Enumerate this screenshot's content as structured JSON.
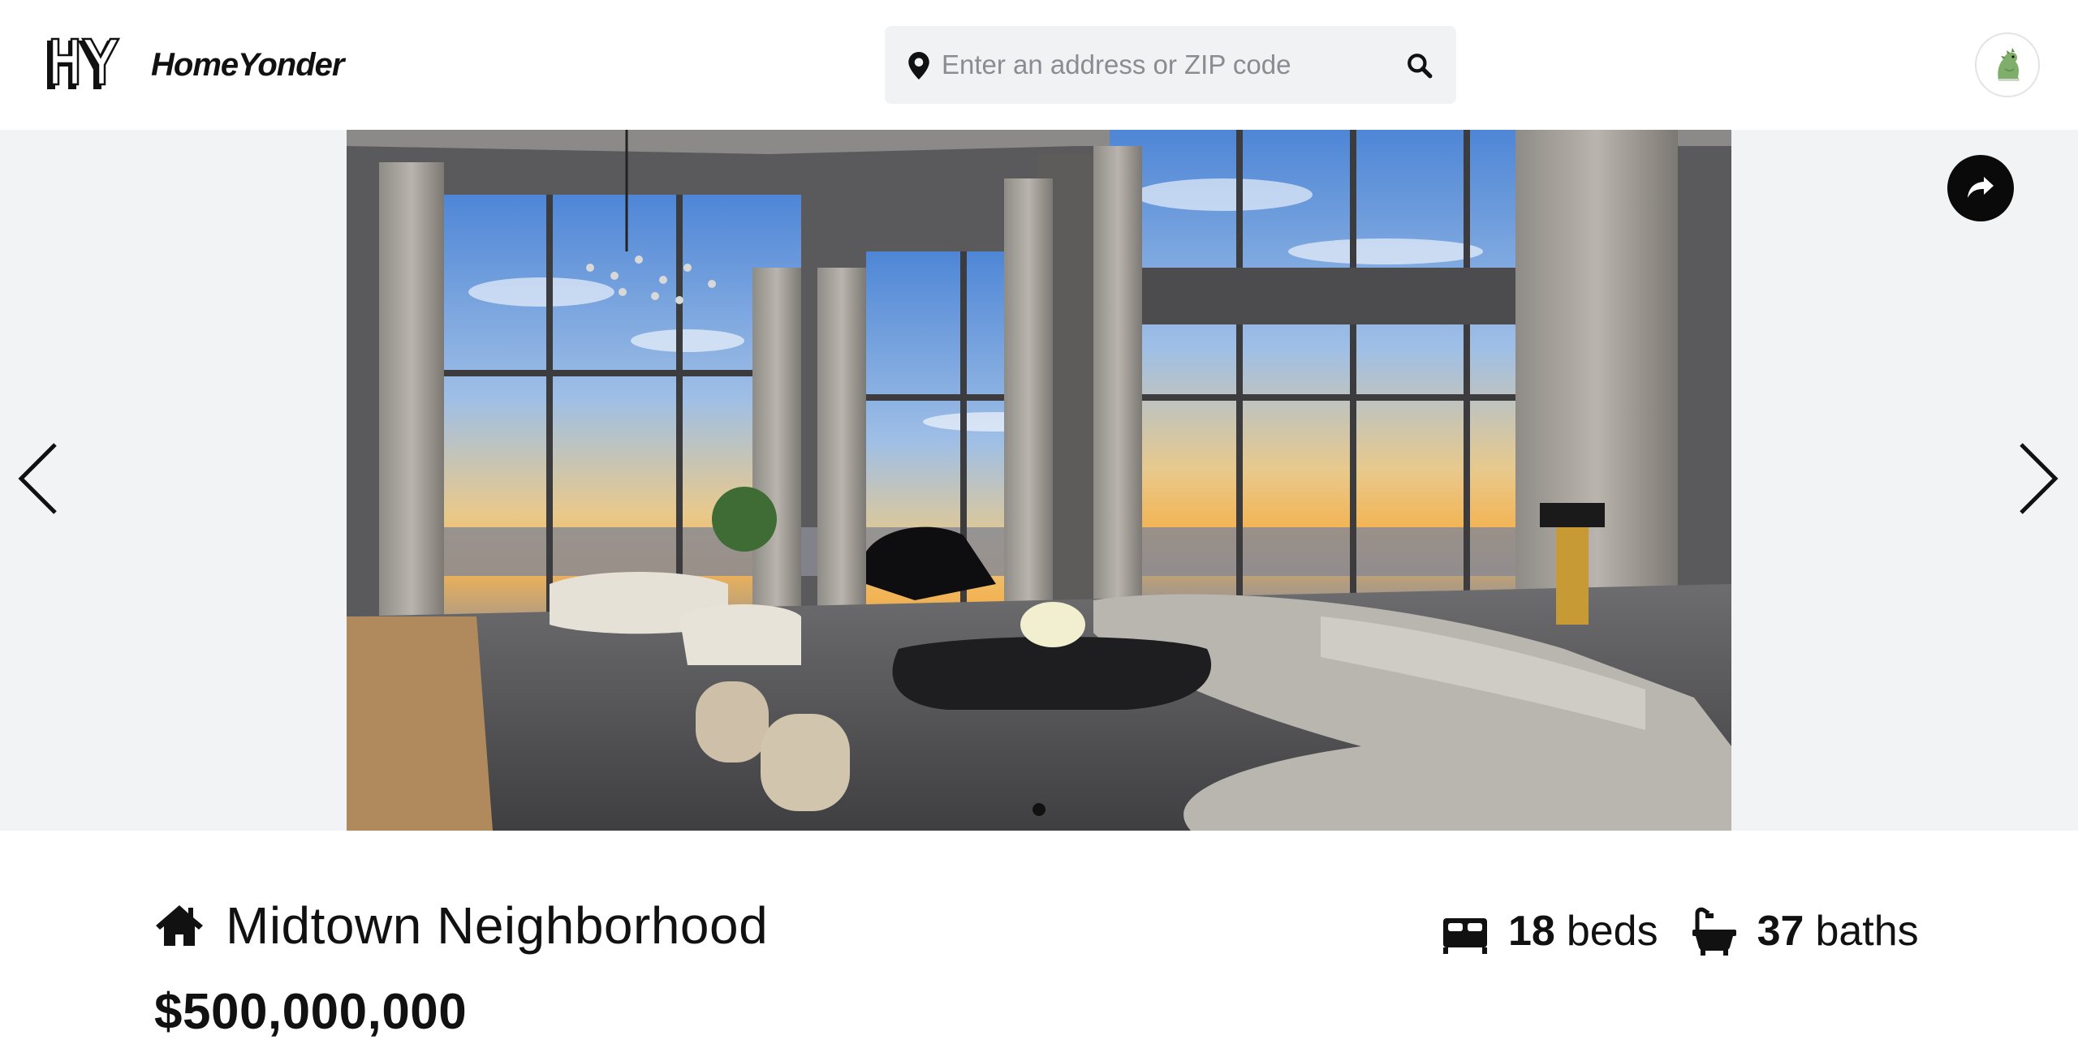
{
  "header": {
    "logo_text": "HomeYonder",
    "search": {
      "placeholder": "Enter an address or ZIP code",
      "value": ""
    }
  },
  "gallery": {
    "image_count": 1,
    "active_index": 0
  },
  "listing": {
    "title": "Midtown Neighborhood",
    "price": "$500,000,000",
    "beds": {
      "count": "18",
      "label": "beds"
    },
    "baths": {
      "count": "37",
      "label": "baths"
    }
  },
  "icons": {
    "location": "map-pin-icon",
    "search": "magnifier-icon",
    "avatar": "dinosaur-avatar",
    "share": "share-arrow-icon",
    "prev": "chevron-left-icon",
    "next": "chevron-right-icon",
    "home": "house-icon",
    "beds": "bed-icon",
    "baths": "bathtub-icon"
  },
  "colors": {
    "text": "#111111",
    "search_bg": "#f1f2f4",
    "gallery_bg": "#f2f3f5",
    "share_bg": "#0a0a0a"
  }
}
